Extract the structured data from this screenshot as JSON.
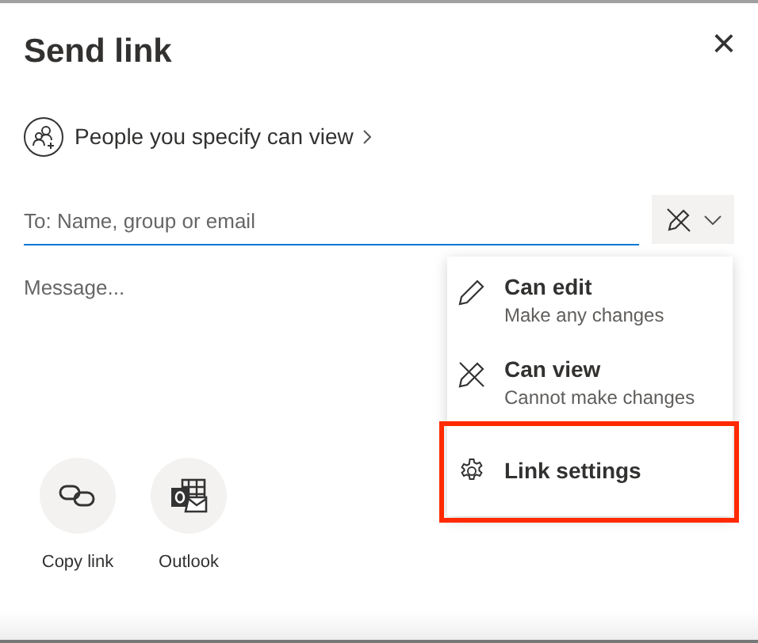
{
  "dialog": {
    "title": "Send link",
    "close": "×"
  },
  "permission_link": {
    "label": "People you specify can view"
  },
  "recipient_field": {
    "placeholder": "To: Name, group or email"
  },
  "message_field": {
    "placeholder": "Message..."
  },
  "permission_menu": {
    "items": [
      {
        "kind": "edit",
        "label": "Can edit",
        "description": "Make any changes",
        "highlighted": false
      },
      {
        "kind": "view",
        "label": "Can view",
        "description": "Cannot make changes",
        "highlighted": false
      },
      {
        "kind": "settings",
        "label": "Link settings",
        "highlighted": true
      }
    ]
  },
  "share_actions": [
    {
      "kind": "copy",
      "label": "Copy link"
    },
    {
      "kind": "outlook",
      "label": "Outlook"
    }
  ]
}
